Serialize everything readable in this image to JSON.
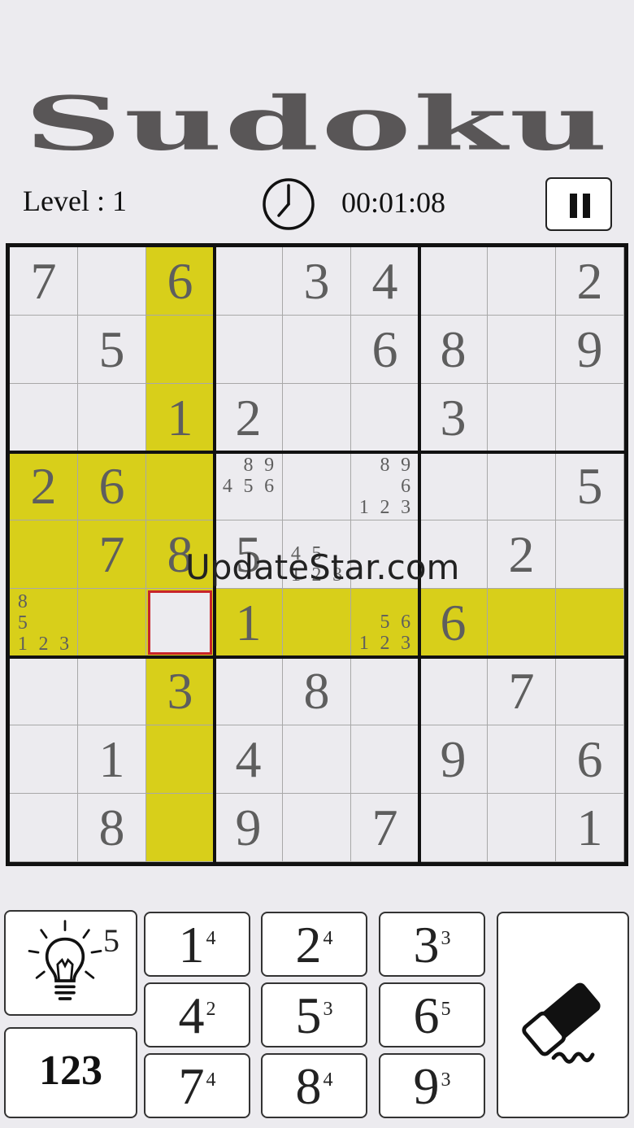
{
  "app": {
    "title": "Sudoku"
  },
  "header": {
    "level_label": "Level : 1",
    "timer": "00:01:08"
  },
  "board": {
    "rows": [
      [
        "7",
        "",
        "6",
        "",
        "3",
        "4",
        "",
        "",
        "2"
      ],
      [
        "",
        "5",
        "",
        "",
        "",
        "6",
        "8",
        "",
        "9"
      ],
      [
        "",
        "",
        "1",
        "2",
        "",
        "",
        "3",
        "",
        ""
      ],
      [
        "2",
        "6",
        "",
        "",
        "",
        "",
        "",
        "",
        "5"
      ],
      [
        "",
        "7",
        "8",
        "5",
        "",
        "",
        "",
        "2",
        ""
      ],
      [
        "",
        "",
        "",
        "1",
        "",
        "",
        "6",
        "",
        ""
      ],
      [
        "",
        "",
        "3",
        "",
        "8",
        "",
        "",
        "7",
        ""
      ],
      [
        "",
        "1",
        "",
        "4",
        "",
        "",
        "9",
        "",
        "6"
      ],
      [
        "",
        "8",
        "",
        "9",
        "",
        "7",
        "",
        "",
        "1"
      ]
    ],
    "notes": [
      {
        "r": 3,
        "c": 3,
        "digits": [
          "",
          "8",
          "9",
          "4",
          "5",
          "6",
          "",
          "",
          ""
        ]
      },
      {
        "r": 3,
        "c": 5,
        "digits": [
          "",
          "8",
          "9",
          "",
          "",
          "6",
          "1",
          "2",
          "3"
        ]
      },
      {
        "r": 4,
        "c": 4,
        "digits": [
          "",
          "",
          "",
          "4",
          "5",
          "",
          "1",
          "2",
          "3"
        ]
      },
      {
        "r": 5,
        "c": 0,
        "digits": [
          "8",
          "",
          "",
          "5",
          "",
          "",
          "1",
          "2",
          "3"
        ]
      },
      {
        "r": 5,
        "c": 5,
        "digits": [
          "",
          "",
          "",
          "",
          "5",
          "6",
          "1",
          "2",
          "3"
        ]
      }
    ],
    "selected": {
      "r": 5,
      "c": 2
    },
    "highlight_color": "#d8cf1a",
    "selection_color": "#c8232a"
  },
  "watermark": "UpdateStar.com",
  "controls": {
    "hint": {
      "icon": "lightbulb-icon",
      "count": "5"
    },
    "mode_label": "123",
    "numbers": [
      {
        "digit": "1",
        "remaining": "4"
      },
      {
        "digit": "2",
        "remaining": "4"
      },
      {
        "digit": "3",
        "remaining": "3"
      },
      {
        "digit": "4",
        "remaining": "2"
      },
      {
        "digit": "5",
        "remaining": "3"
      },
      {
        "digit": "6",
        "remaining": "5"
      },
      {
        "digit": "7",
        "remaining": "4"
      },
      {
        "digit": "8",
        "remaining": "4"
      },
      {
        "digit": "9",
        "remaining": "3"
      }
    ],
    "eraser": {
      "icon": "eraser-icon"
    }
  }
}
